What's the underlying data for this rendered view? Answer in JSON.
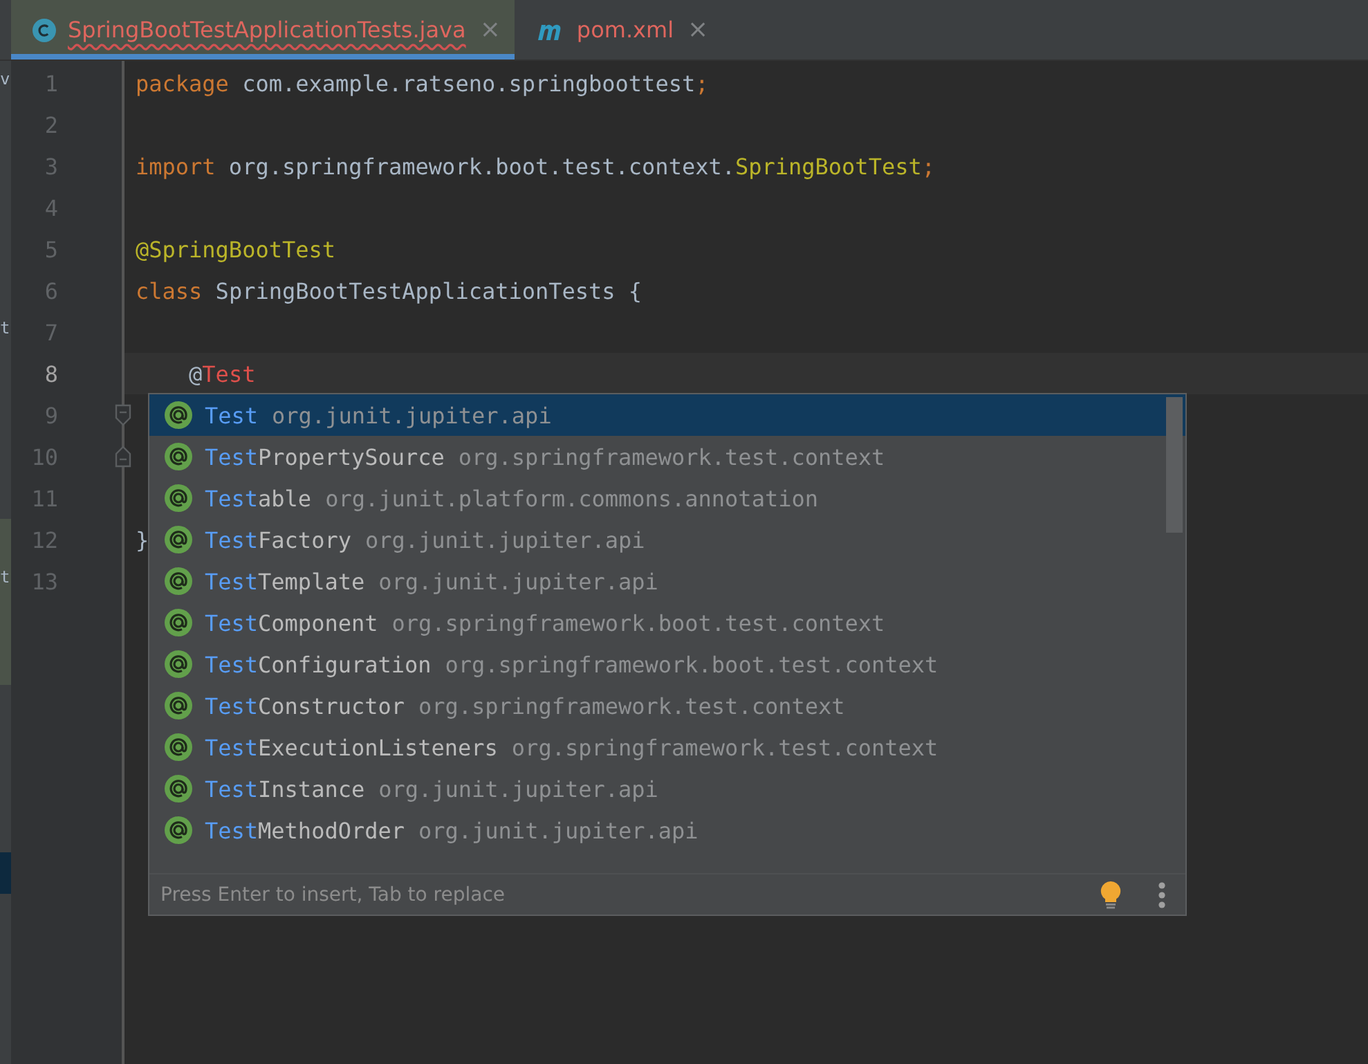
{
  "tabs": [
    {
      "kind": "java",
      "label": "SpringBootTestApplicationTests.java",
      "selected": true,
      "error": true,
      "close": "×"
    },
    {
      "kind": "maven",
      "label": "pom.xml",
      "selected": false,
      "error": true,
      "close": "×"
    }
  ],
  "project_panel": {
    "fragments": [
      {
        "text": "v"
      },
      {
        "text": "t"
      },
      {
        "text": "t"
      }
    ]
  },
  "editor": {
    "lines": [
      {
        "number": "1",
        "current": false,
        "segments": [
          {
            "kind": "keyword",
            "text": "package"
          },
          {
            "kind": "plain",
            "text": " com.example.ratseno.springboottest"
          },
          {
            "kind": "keyword",
            "text": ";"
          }
        ]
      },
      {
        "number": "2",
        "current": false
      },
      {
        "number": "3",
        "current": false,
        "segments": [
          {
            "kind": "keyword",
            "text": "import"
          },
          {
            "kind": "plain",
            "text": " org.springframework.boot.test.context."
          },
          {
            "kind": "annotation",
            "text": "SpringBootTest"
          },
          {
            "kind": "keyword",
            "text": ";"
          }
        ]
      },
      {
        "number": "4",
        "current": false
      },
      {
        "number": "5",
        "current": false,
        "segments": [
          {
            "kind": "annotation",
            "text": "@SpringBootTest"
          }
        ]
      },
      {
        "number": "6",
        "current": false,
        "segments": [
          {
            "kind": "keyword",
            "text": "class"
          },
          {
            "kind": "plain",
            "text": " SpringBootTestApplicationTests {"
          }
        ]
      },
      {
        "number": "7",
        "current": false
      },
      {
        "number": "8",
        "current": true,
        "segments": [
          {
            "kind": "plain",
            "text": "    @"
          },
          {
            "kind": "error",
            "text": "Test"
          }
        ]
      },
      {
        "number": "9",
        "current": false,
        "fold_start": true
      },
      {
        "number": "10",
        "current": false,
        "fold_end": true
      },
      {
        "number": "11",
        "current": false
      },
      {
        "number": "12",
        "current": false,
        "segments": [
          {
            "kind": "plain",
            "text": "}"
          }
        ]
      },
      {
        "number": "13",
        "current": false
      }
    ]
  },
  "completion": {
    "items": [
      {
        "match": "Test",
        "package": "org.junit.jupiter.api",
        "selected": true
      },
      {
        "match": "Test",
        "rest": "PropertySource",
        "package": "org.springframework.test.context",
        "selected": false
      },
      {
        "match": "Test",
        "rest": "able",
        "package": "org.junit.platform.commons.annotation",
        "selected": false
      },
      {
        "match": "Test",
        "rest": "Factory",
        "package": "org.junit.jupiter.api",
        "selected": false
      },
      {
        "match": "Test",
        "rest": "Template",
        "package": "org.junit.jupiter.api",
        "selected": false
      },
      {
        "match": "Test",
        "rest": "Component",
        "package": "org.springframework.boot.test.context",
        "selected": false
      },
      {
        "match": "Test",
        "rest": "Configuration",
        "package": "org.springframework.boot.test.context",
        "selected": false
      },
      {
        "match": "Test",
        "rest": "Constructor",
        "package": "org.springframework.test.context",
        "selected": false
      },
      {
        "match": "Test",
        "rest": "ExecutionListeners",
        "package": "org.springframework.test.context",
        "selected": false
      },
      {
        "match": "Test",
        "rest": "Instance",
        "package": "org.junit.jupiter.api",
        "selected": false
      },
      {
        "match": "Test",
        "rest": "MethodOrder",
        "package": "org.junit.jupiter.api",
        "selected": false
      }
    ],
    "hint": "Press Enter to insert, Tab to replace"
  }
}
